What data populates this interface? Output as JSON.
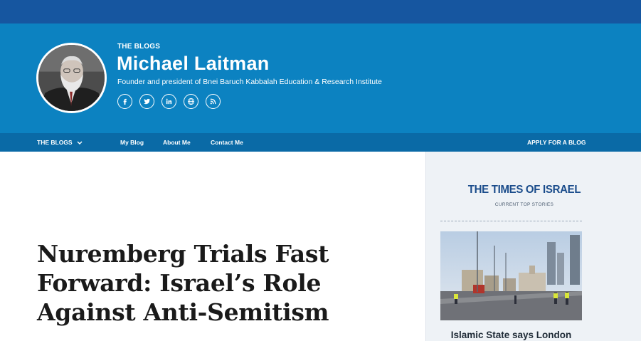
{
  "header": {
    "kicker": "THE BLOGS",
    "author_name": "Michael Laitman",
    "author_desc": "Founder and president of Bnei Baruch Kabbalah Education & Research Institute",
    "social_icons": [
      "facebook-icon",
      "twitter-icon",
      "linkedin-icon",
      "website-icon",
      "rss-icon"
    ]
  },
  "nav": {
    "blogs_menu": "THE BLOGS",
    "my_blog": "My Blog",
    "about_me": "About Me",
    "contact_me": "Contact Me",
    "apply": "APPLY FOR A BLOG"
  },
  "article": {
    "title_line1": "Nuremberg Trials Fast",
    "title_line2": "Forward: Israel’s Role",
    "title_line3": "Against Anti-Semitism"
  },
  "sidebar": {
    "brand": "THE TIMES OF ISRAEL",
    "subtitle": "CURRENT TOP STORIES",
    "story_title": "Islamic State says London"
  },
  "colors": {
    "topbar": "#1656a0",
    "header": "#0c82c1",
    "navbar": "#0a6aa6",
    "brand_blue": "#1a4c8b"
  }
}
